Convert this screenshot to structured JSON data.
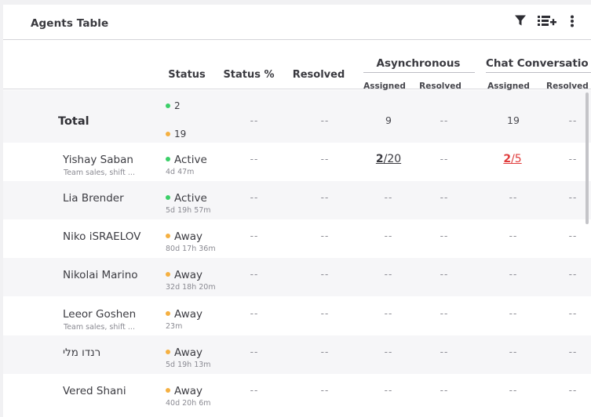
{
  "card": {
    "title": "Agents Table",
    "icons": [
      "filter-icon",
      "add-column-icon",
      "more-vert-icon"
    ]
  },
  "columns": {
    "status": "Status",
    "status_pct": "Status %",
    "resolved": "Resolved",
    "groups": [
      {
        "title": "Asynchronous",
        "sub": [
          "Assigned",
          "Resolved"
        ]
      },
      {
        "title": "Chat Conversatio",
        "sub": [
          "Assigned",
          "Resolved"
        ]
      }
    ]
  },
  "total": {
    "label": "Total",
    "active_count": "2",
    "away_count": "19",
    "status_pct": "--",
    "resolved": "--",
    "async_assigned": "9",
    "async_resolved": "--",
    "chat_assigned": "19",
    "chat_resolved": "--"
  },
  "agents": [
    {
      "name": "Yishay Saban",
      "sub": "Team sales, shift ...",
      "status": "Active",
      "time": "4d 47m",
      "status_pct": "--",
      "resolved": "--",
      "async_assigned_num": "2",
      "async_assigned_den": "/20",
      "async_resolved": "--",
      "chat_assigned_num": "2",
      "chat_assigned_den": "/5",
      "chat_resolved": "--"
    },
    {
      "name": "Lia Brender",
      "sub": "",
      "status": "Active",
      "time": "5d 19h 57m",
      "status_pct": "--",
      "resolved": "--",
      "async_assigned": "--",
      "async_resolved": "--",
      "chat_assigned": "--",
      "chat_resolved": "--"
    },
    {
      "name": "Niko iSRAELOV",
      "sub": "",
      "status": "Away",
      "time": "80d 17h 36m",
      "status_pct": "--",
      "resolved": "--",
      "async_assigned": "--",
      "async_resolved": "--",
      "chat_assigned": "--",
      "chat_resolved": "--"
    },
    {
      "name": "Nikolai Marino",
      "sub": "",
      "status": "Away",
      "time": "32d 18h 20m",
      "status_pct": "--",
      "resolved": "--",
      "async_assigned": "--",
      "async_resolved": "--",
      "chat_assigned": "--",
      "chat_resolved": "--"
    },
    {
      "name": "Leeor Goshen",
      "sub": "Team sales, shift ...",
      "status": "Away",
      "time": "23m",
      "status_pct": "--",
      "resolved": "--",
      "async_assigned": "--",
      "async_resolved": "--",
      "chat_assigned": "--",
      "chat_resolved": "--"
    },
    {
      "name": "רנדו מלי",
      "sub": "",
      "status": "Away",
      "time": "5d 19h 13m",
      "status_pct": "--",
      "resolved": "--",
      "async_assigned": "--",
      "async_resolved": "--",
      "chat_assigned": "--",
      "chat_resolved": "--"
    },
    {
      "name": "Vered Shani",
      "sub": "",
      "status": "Away",
      "time": "40d 20h 6m",
      "status_pct": "--",
      "resolved": "--",
      "async_assigned": "--",
      "async_resolved": "--",
      "chat_assigned": "--",
      "chat_resolved": "--"
    }
  ],
  "colors": {
    "active": "#3bcf68",
    "away": "#f5b041",
    "alert": "#e03c3c"
  }
}
